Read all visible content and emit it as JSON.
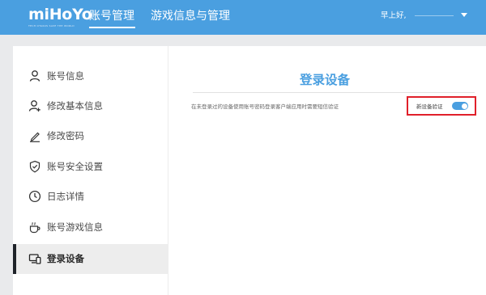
{
  "header": {
    "logo_text": "miHoYo",
    "logo_tagline": "TECH OTAKUS SAVE THE WORLD",
    "nav": [
      "账号管理",
      "游戏信息与管理"
    ],
    "greeting": "早上好,"
  },
  "sidebar": {
    "items": [
      {
        "label": "账号信息",
        "icon": "person-icon"
      },
      {
        "label": "修改基本信息",
        "icon": "person-add-icon"
      },
      {
        "label": "修改密码",
        "icon": "pencil-icon"
      },
      {
        "label": "账号安全设置",
        "icon": "shield-icon"
      },
      {
        "label": "日志详情",
        "icon": "clock-icon"
      },
      {
        "label": "账号游戏信息",
        "icon": "coffee-cup-icon"
      },
      {
        "label": "登录设备",
        "icon": "devices-icon"
      }
    ],
    "active_index": 6
  },
  "main": {
    "title": "登录设备",
    "description": "在未登录过的设备使用账号密码登录客户端应用时需要短信验证",
    "toggle_label": "新设备验证",
    "toggle_on": true
  },
  "colors": {
    "header_bg": "#4a9fe0",
    "accent": "#4a9fe0",
    "highlight": "#e0202a"
  }
}
